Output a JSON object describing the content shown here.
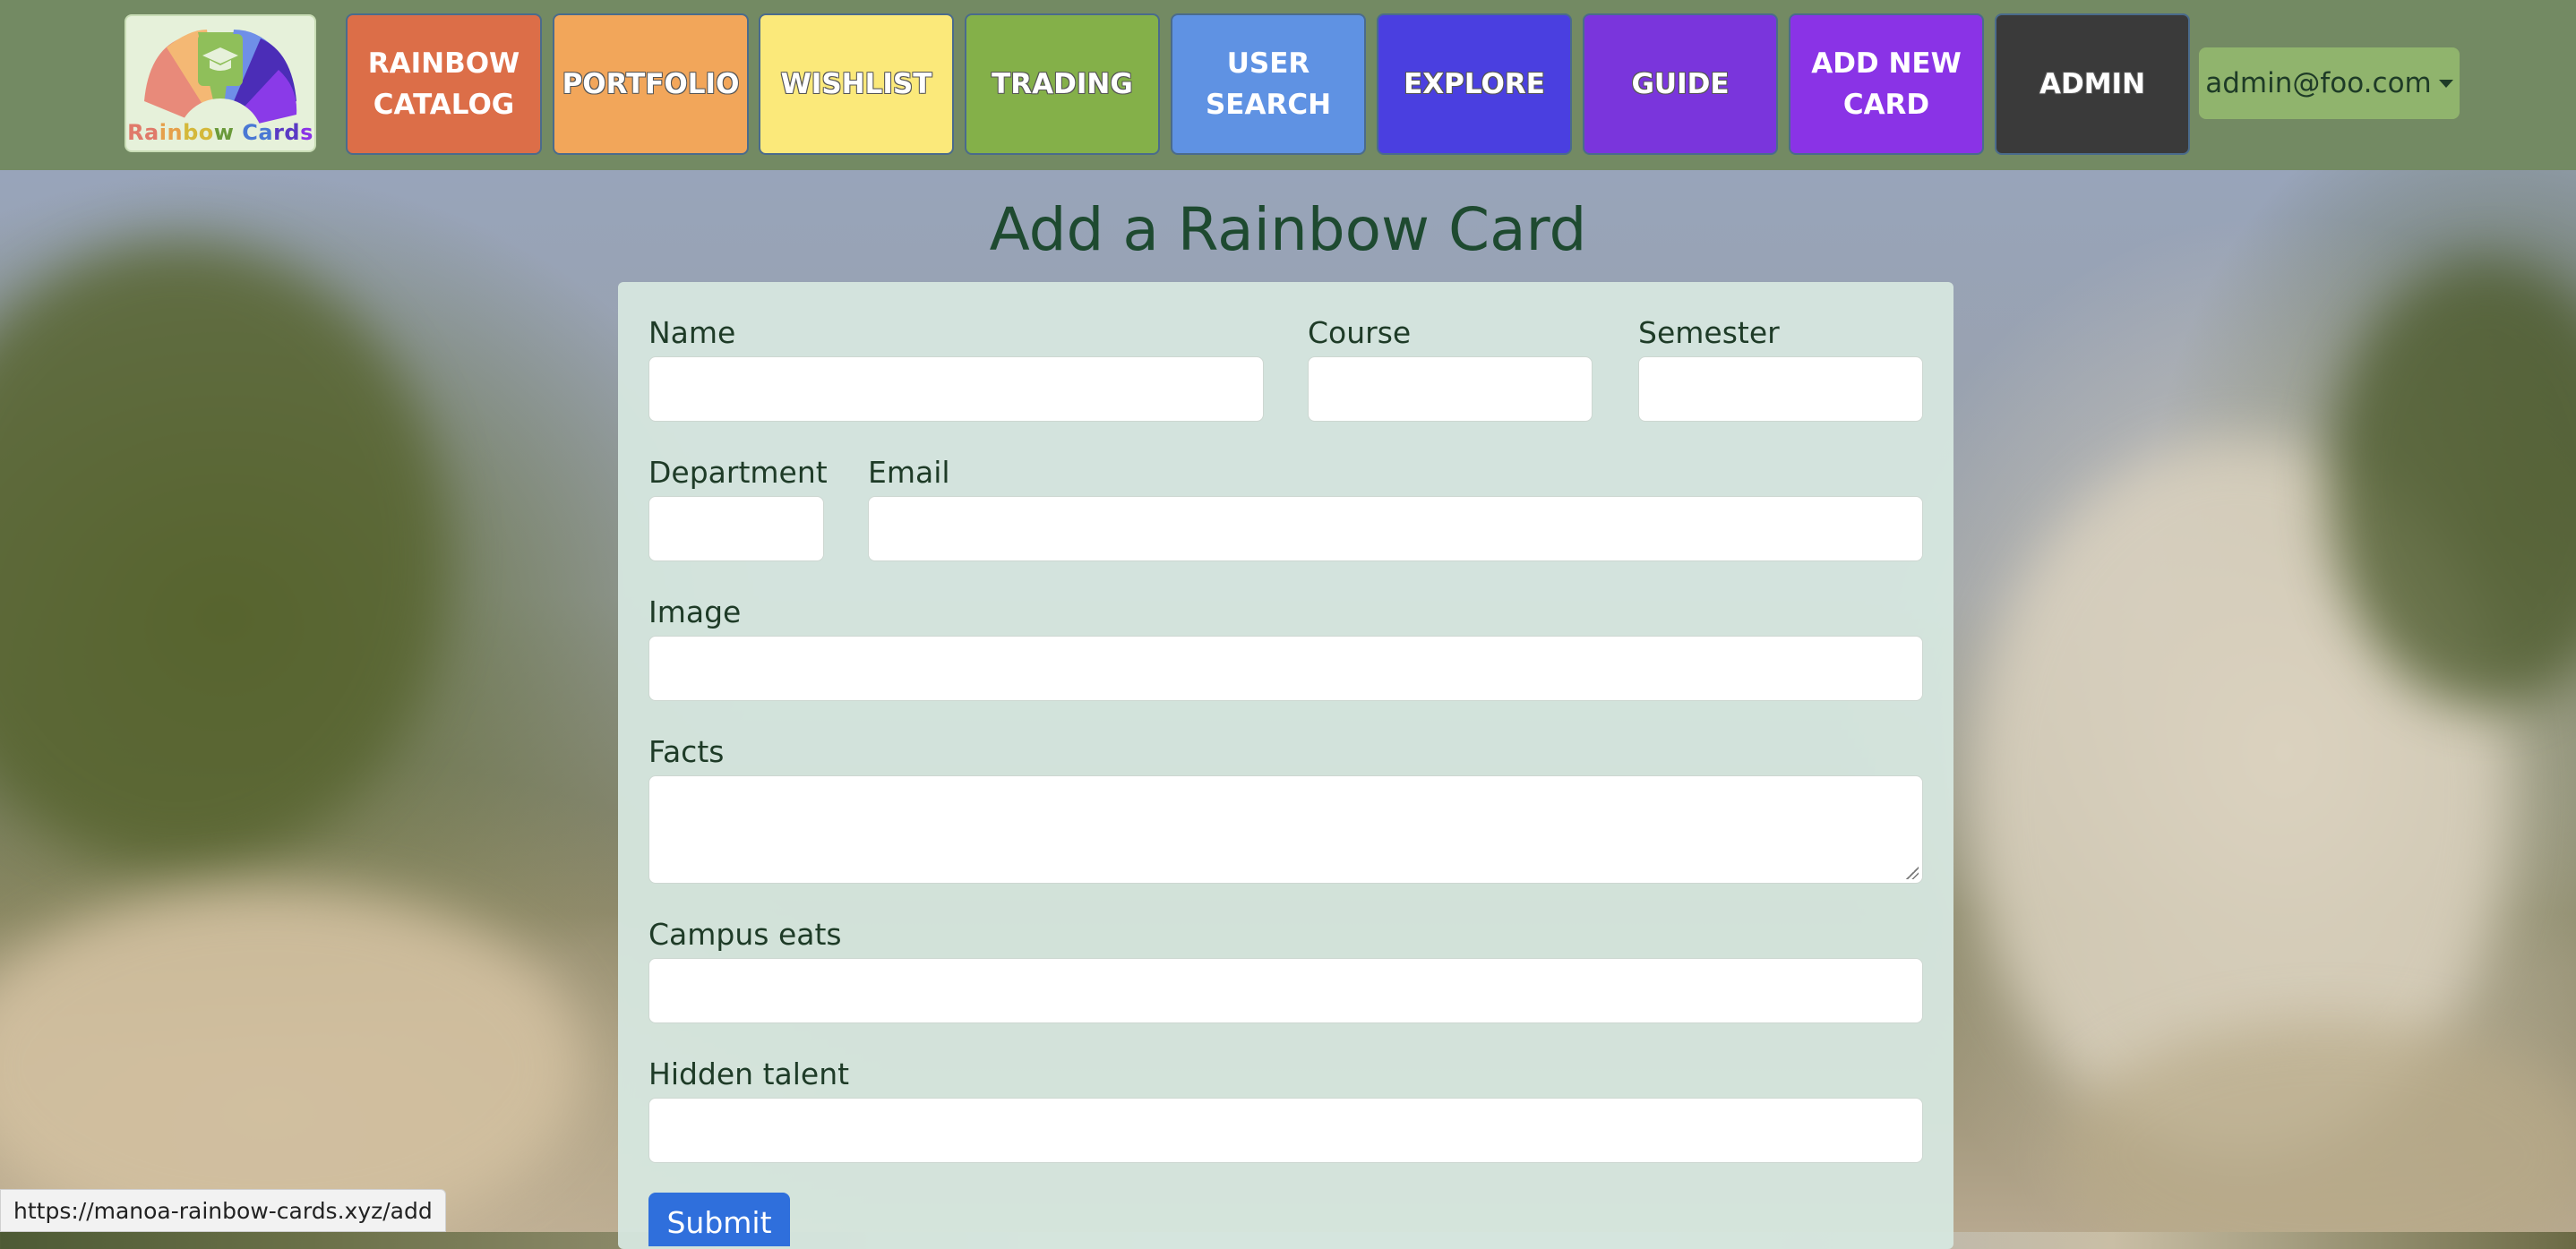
{
  "navbar": {
    "logo_text": "Rainbow Cards",
    "buttons": [
      {
        "label": "RAINBOW\nCATALOG",
        "color": "#dc6e48"
      },
      {
        "label": "PORTFOLIO",
        "color": "#f2a65a"
      },
      {
        "label": "WISHLIST",
        "color": "#fbe97a"
      },
      {
        "label": "TRADING",
        "color": "#84b049"
      },
      {
        "label": "USER\nSEARCH",
        "color": "#5f92e3"
      },
      {
        "label": "EXPLORE",
        "color": "#4a3fe0"
      },
      {
        "label": "GUIDE",
        "color": "#7a35dc"
      },
      {
        "label": "ADD NEW\nCARD",
        "color": "#8a33e6"
      },
      {
        "label": "ADMIN",
        "color": "#3a3a3a"
      }
    ],
    "user_menu": "admin@foo.com"
  },
  "page": {
    "title": "Add a Rainbow Card"
  },
  "form": {
    "name_label": "Name",
    "course_label": "Course",
    "semester_label": "Semester",
    "department_label": "Department",
    "email_label": "Email",
    "image_label": "Image",
    "facts_label": "Facts",
    "campus_eats_label": "Campus eats",
    "hidden_talent_label": "Hidden talent",
    "submit_label": "Submit"
  },
  "statusbar": {
    "url": "https://manoa-rainbow-cards.xyz/add"
  }
}
